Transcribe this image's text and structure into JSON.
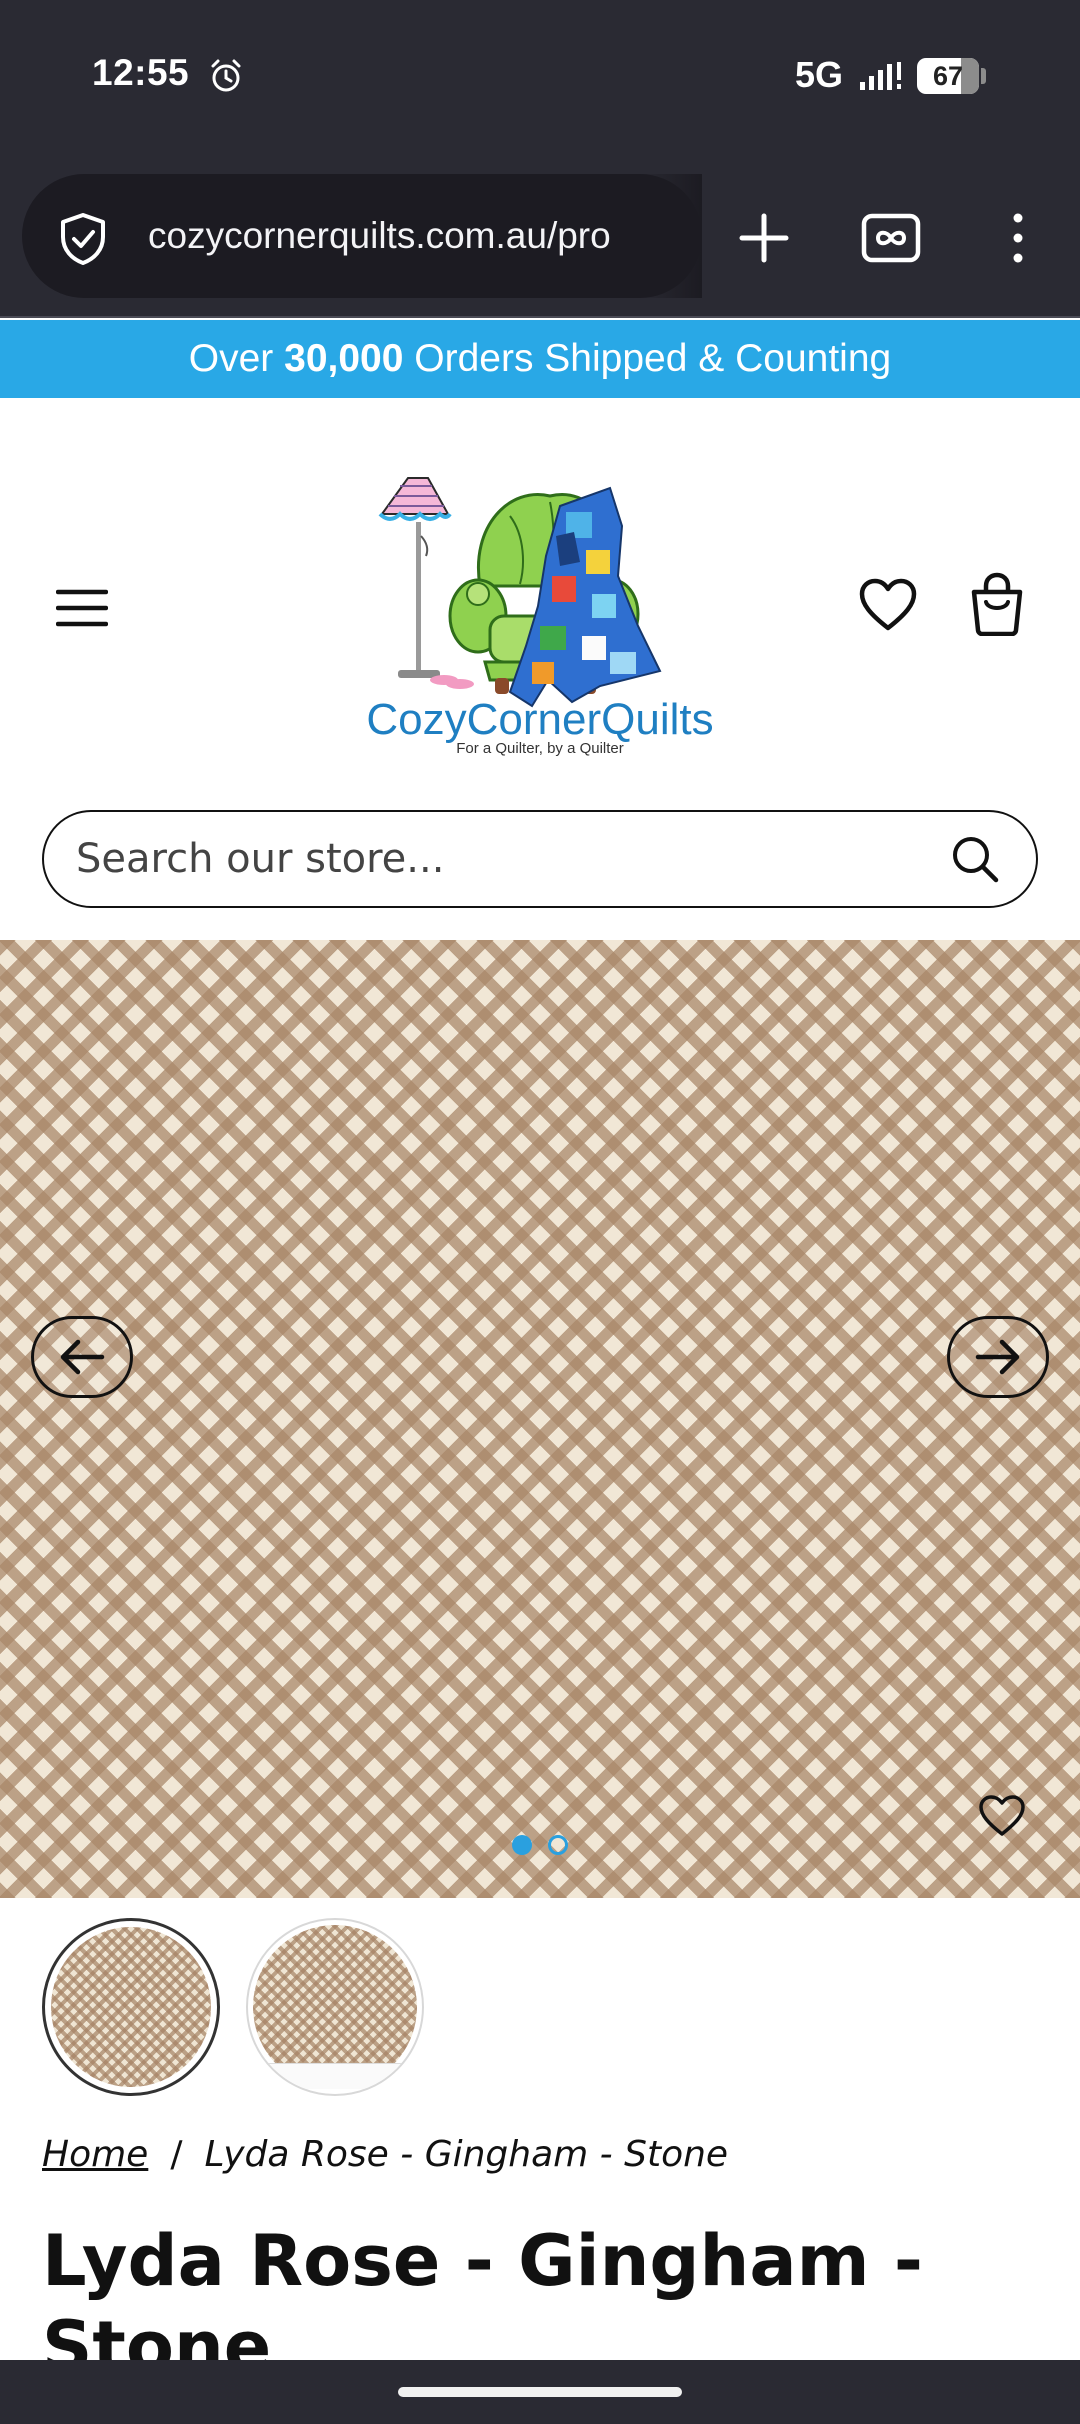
{
  "status_bar": {
    "time": "12:55",
    "network": "5G",
    "battery": "67",
    "icons": [
      "alarm-icon",
      "signal-icon",
      "battery-icon"
    ]
  },
  "browser": {
    "url": "cozycornerquilts.com.au/pro",
    "icons": [
      "shield-icon",
      "new-tab-icon",
      "tabs-icon",
      "menu-kebab-icon"
    ]
  },
  "announcement": {
    "prefix": "Over",
    "count": "30,000",
    "suffix": "Orders Shipped & Counting",
    "background": "#29a8e6"
  },
  "header": {
    "logo_name": "CozyCornerQuilts",
    "logo_tagline": "For a Quilter, by a Quilter",
    "icons": [
      "hamburger-icon",
      "heart-icon",
      "shopping-bag-icon"
    ]
  },
  "search": {
    "placeholder": "Search our store..."
  },
  "gallery": {
    "slide_count": 2,
    "active_slide": 1,
    "icons": [
      "arrow-left-icon",
      "arrow-right-icon",
      "heart-icon"
    ],
    "accent": "#2aa0df"
  },
  "breadcrumb": {
    "home": "Home",
    "separator": "/",
    "current": "Lyda Rose - Gingham - Stone"
  },
  "product": {
    "title": "Lyda Rose - Gingham - Stone"
  }
}
